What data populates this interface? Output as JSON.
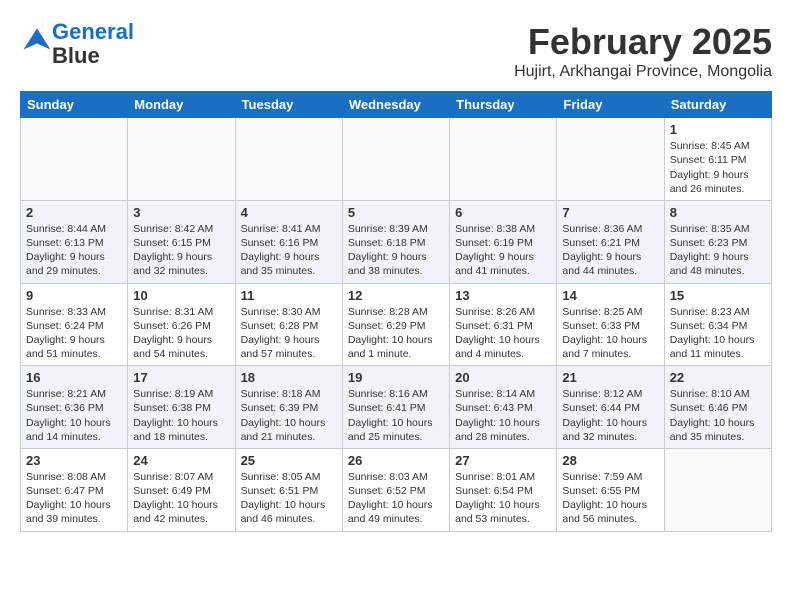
{
  "logo": {
    "line1": "General",
    "line2": "Blue"
  },
  "title": "February 2025",
  "location": "Hujirt, Arkhangai Province, Mongolia",
  "weekdays": [
    "Sunday",
    "Monday",
    "Tuesday",
    "Wednesday",
    "Thursday",
    "Friday",
    "Saturday"
  ],
  "weeks": [
    [
      {
        "day": "",
        "info": ""
      },
      {
        "day": "",
        "info": ""
      },
      {
        "day": "",
        "info": ""
      },
      {
        "day": "",
        "info": ""
      },
      {
        "day": "",
        "info": ""
      },
      {
        "day": "",
        "info": ""
      },
      {
        "day": "1",
        "info": "Sunrise: 8:45 AM\nSunset: 6:11 PM\nDaylight: 9 hours and 26 minutes."
      }
    ],
    [
      {
        "day": "2",
        "info": "Sunrise: 8:44 AM\nSunset: 6:13 PM\nDaylight: 9 hours and 29 minutes."
      },
      {
        "day": "3",
        "info": "Sunrise: 8:42 AM\nSunset: 6:15 PM\nDaylight: 9 hours and 32 minutes."
      },
      {
        "day": "4",
        "info": "Sunrise: 8:41 AM\nSunset: 6:16 PM\nDaylight: 9 hours and 35 minutes."
      },
      {
        "day": "5",
        "info": "Sunrise: 8:39 AM\nSunset: 6:18 PM\nDaylight: 9 hours and 38 minutes."
      },
      {
        "day": "6",
        "info": "Sunrise: 8:38 AM\nSunset: 6:19 PM\nDaylight: 9 hours and 41 minutes."
      },
      {
        "day": "7",
        "info": "Sunrise: 8:36 AM\nSunset: 6:21 PM\nDaylight: 9 hours and 44 minutes."
      },
      {
        "day": "8",
        "info": "Sunrise: 8:35 AM\nSunset: 6:23 PM\nDaylight: 9 hours and 48 minutes."
      }
    ],
    [
      {
        "day": "9",
        "info": "Sunrise: 8:33 AM\nSunset: 6:24 PM\nDaylight: 9 hours and 51 minutes."
      },
      {
        "day": "10",
        "info": "Sunrise: 8:31 AM\nSunset: 6:26 PM\nDaylight: 9 hours and 54 minutes."
      },
      {
        "day": "11",
        "info": "Sunrise: 8:30 AM\nSunset: 6:28 PM\nDaylight: 9 hours and 57 minutes."
      },
      {
        "day": "12",
        "info": "Sunrise: 8:28 AM\nSunset: 6:29 PM\nDaylight: 10 hours and 1 minute."
      },
      {
        "day": "13",
        "info": "Sunrise: 8:26 AM\nSunset: 6:31 PM\nDaylight: 10 hours and 4 minutes."
      },
      {
        "day": "14",
        "info": "Sunrise: 8:25 AM\nSunset: 6:33 PM\nDaylight: 10 hours and 7 minutes."
      },
      {
        "day": "15",
        "info": "Sunrise: 8:23 AM\nSunset: 6:34 PM\nDaylight: 10 hours and 11 minutes."
      }
    ],
    [
      {
        "day": "16",
        "info": "Sunrise: 8:21 AM\nSunset: 6:36 PM\nDaylight: 10 hours and 14 minutes."
      },
      {
        "day": "17",
        "info": "Sunrise: 8:19 AM\nSunset: 6:38 PM\nDaylight: 10 hours and 18 minutes."
      },
      {
        "day": "18",
        "info": "Sunrise: 8:18 AM\nSunset: 6:39 PM\nDaylight: 10 hours and 21 minutes."
      },
      {
        "day": "19",
        "info": "Sunrise: 8:16 AM\nSunset: 6:41 PM\nDaylight: 10 hours and 25 minutes."
      },
      {
        "day": "20",
        "info": "Sunrise: 8:14 AM\nSunset: 6:43 PM\nDaylight: 10 hours and 28 minutes."
      },
      {
        "day": "21",
        "info": "Sunrise: 8:12 AM\nSunset: 6:44 PM\nDaylight: 10 hours and 32 minutes."
      },
      {
        "day": "22",
        "info": "Sunrise: 8:10 AM\nSunset: 6:46 PM\nDaylight: 10 hours and 35 minutes."
      }
    ],
    [
      {
        "day": "23",
        "info": "Sunrise: 8:08 AM\nSunset: 6:47 PM\nDaylight: 10 hours and 39 minutes."
      },
      {
        "day": "24",
        "info": "Sunrise: 8:07 AM\nSunset: 6:49 PM\nDaylight: 10 hours and 42 minutes."
      },
      {
        "day": "25",
        "info": "Sunrise: 8:05 AM\nSunset: 6:51 PM\nDaylight: 10 hours and 46 minutes."
      },
      {
        "day": "26",
        "info": "Sunrise: 8:03 AM\nSunset: 6:52 PM\nDaylight: 10 hours and 49 minutes."
      },
      {
        "day": "27",
        "info": "Sunrise: 8:01 AM\nSunset: 6:54 PM\nDaylight: 10 hours and 53 minutes."
      },
      {
        "day": "28",
        "info": "Sunrise: 7:59 AM\nSunset: 6:55 PM\nDaylight: 10 hours and 56 minutes."
      },
      {
        "day": "",
        "info": ""
      }
    ]
  ]
}
